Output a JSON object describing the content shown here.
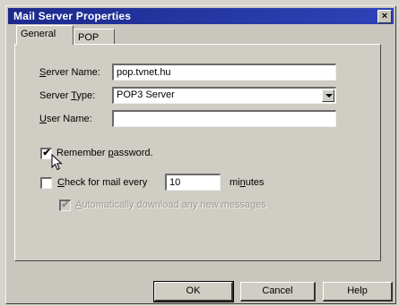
{
  "window": {
    "title": "Mail Server Properties",
    "close_glyph": "×"
  },
  "tabs": [
    {
      "label": "General",
      "active": true
    },
    {
      "label": "POP",
      "active": false
    }
  ],
  "form": {
    "server_name": {
      "label_pre": "",
      "label_u": "S",
      "label_post": "erver Name:",
      "value": "pop.tvnet.hu"
    },
    "server_type": {
      "label_pre": "Server ",
      "label_u": "T",
      "label_post": "ype:",
      "value": "POP3 Server"
    },
    "user_name": {
      "label_pre": "",
      "label_u": "U",
      "label_post": "ser Name:",
      "value": ""
    },
    "remember_password": {
      "label_pre": "Remember ",
      "label_u": "p",
      "label_post": "assword.",
      "checked": true
    },
    "check_mail": {
      "label_pre": "",
      "label_u": "C",
      "label_post": "heck for mail every",
      "checked": false,
      "value": "10",
      "units_pre": "mi",
      "units_u": "n",
      "units_post": "utes"
    },
    "auto_download": {
      "label_pre": "",
      "label_u": "A",
      "label_post": "utomatically download any new messages",
      "checked": true,
      "disabled": true
    }
  },
  "buttons": {
    "ok": "OK",
    "cancel": "Cancel",
    "help": "Help"
  },
  "check_glyph": "✔",
  "icons": {
    "close": "close-icon",
    "dropdown": "chevron-down-icon",
    "cursor": "mouse-pointer-icon"
  }
}
